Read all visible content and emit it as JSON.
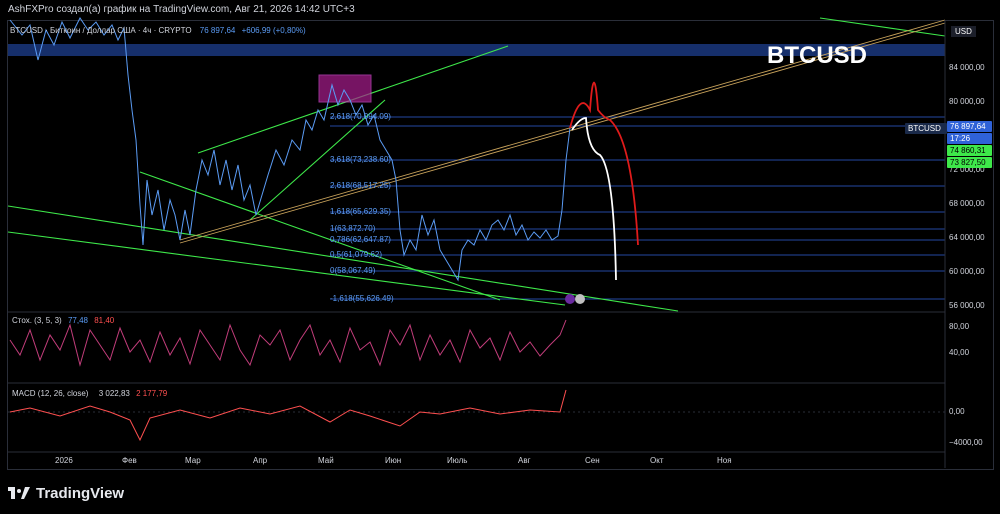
{
  "header": {
    "text": "AshFXPro создал(а) график на TradingView.com, Авг 21, 2026 14:42 UTC+3"
  },
  "symbol": {
    "legend": "BTCUSD · Биткоин / Доллар США · 4ч · CRYPTO",
    "price": "76 897,64",
    "change": "+606,99 (+0,80%)",
    "big_title": "BTCUSD"
  },
  "price_axis": {
    "currency": "USD",
    "labels": [
      "84 000,00",
      "80 000,00",
      "76 000,00",
      "72 000,00",
      "68 000,00",
      "64 000,00",
      "60 000,00",
      "56 000,00"
    ]
  },
  "price_tags": {
    "symbol": "BTCUSD",
    "current": "76 897,64",
    "countdown": "17:26",
    "level_a": "74 860,31",
    "level_b": "73 827,50"
  },
  "stoch": {
    "title": "Стох. (3, 5, 3)",
    "k": "77,48",
    "d": "81,40",
    "axis": [
      "80,00",
      "40,00"
    ]
  },
  "macd": {
    "title": "MACD (12, 26, close)",
    "v1": "3 022,83",
    "v2": "2 177,79",
    "axis": [
      "0,00",
      "−4000,00"
    ]
  },
  "time_axis": {
    "labels": [
      "2026",
      "Фев",
      "Мар",
      "Апр",
      "Май",
      "Июн",
      "Июль",
      "Авг",
      "Сен",
      "Окт",
      "Ноя"
    ]
  },
  "fib_labels": [
    "2,618(70,094.09)",
    "3,618(73,238.60)",
    "2,618(68,517.25)",
    "1,618(65,629.35)",
    "1(63,872.70)",
    "0,786(62,647.87)",
    "0,5(61,079.62)",
    "0(58,067.49)",
    "-1,618(55,626.49)"
  ],
  "brand": {
    "name": "TradingView"
  },
  "colors": {
    "price_line": "#5b9cf5",
    "trendline": "#3ee84a",
    "stoch": "#c23d7b",
    "macd": "#ff5050",
    "projection_up": "#e01b1b",
    "projection_down": "#ffffff"
  },
  "chart_data": [
    {
      "type": "line",
      "title": "BTCUSD · 4ч",
      "x": [
        "2026",
        "Фев",
        "Мар",
        "Апр",
        "Май",
        "Июн",
        "Июль",
        "Авг",
        "Сен"
      ],
      "series": [
        {
          "name": "BTCUSD",
          "values": [
            87000,
            83000,
            67000,
            68000,
            78000,
            68000,
            60000,
            65000,
            76900
          ]
        }
      ],
      "ylim": [
        55000,
        86000
      ]
    },
    {
      "type": "line",
      "title": "Стох. (3, 5, 3)",
      "series": [
        {
          "name": "%K",
          "values": [
            60,
            40,
            70,
            30,
            65,
            45,
            55,
            77.48
          ]
        }
      ],
      "ylim": [
        0,
        100
      ]
    },
    {
      "type": "bar",
      "title": "MACD (12, 26, close)",
      "values": [
        200,
        -300,
        500,
        -1500,
        800,
        -600,
        300,
        3022.83
      ],
      "ylim": [
        -5000,
        3500
      ]
    }
  ]
}
